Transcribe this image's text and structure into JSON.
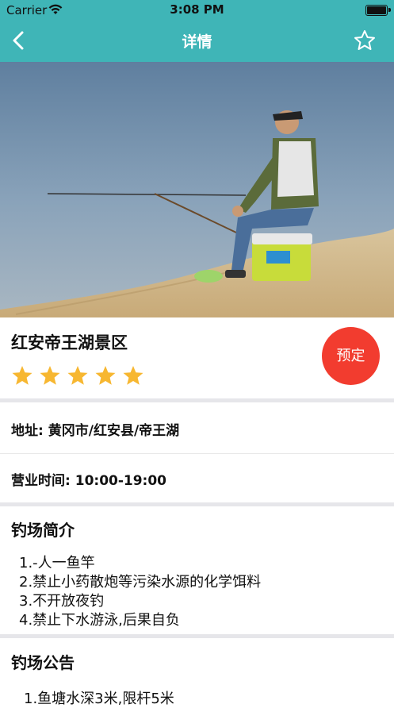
{
  "status_bar": {
    "carrier": "Carrier",
    "time": "3:08 PM"
  },
  "nav": {
    "title": "详情",
    "back_icon": "chevron-left-icon",
    "favorite_icon": "star-outline-icon"
  },
  "spot": {
    "name": "红安帝王湖景区",
    "rating": 5,
    "rating_max": 5,
    "book_label": "预定",
    "star_color": "#f7b731",
    "book_color": "#f23c2f"
  },
  "address": {
    "label": "地址:",
    "value": "黄冈市/红安县/帝王湖"
  },
  "hours": {
    "label": "营业时间:",
    "value": "10:00-19:00"
  },
  "intro": {
    "title": "钓场简介",
    "lines": [
      "1.-人一鱼竿",
      "2.禁止小药散炮等污染水源的化学饵料",
      " 3.不开放夜钓",
      " 4.禁止下水游泳,后果自负"
    ]
  },
  "notice": {
    "title": "钓场公告",
    "lines": [
      "1.鱼塘水深3米,限杆5米"
    ]
  },
  "theme": {
    "accent": "#3fb5b7"
  }
}
